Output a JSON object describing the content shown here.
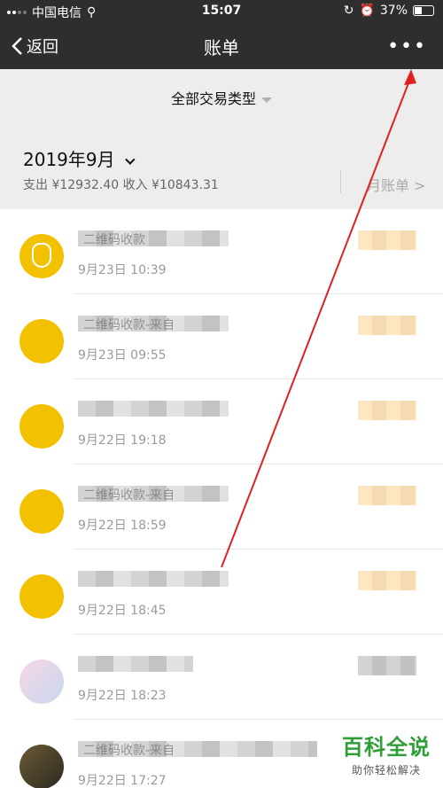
{
  "status_bar": {
    "carrier": "中国电信",
    "time": "15:07",
    "battery": "37%"
  },
  "nav": {
    "back_label": "返回",
    "title": "账单",
    "more_label": "•••"
  },
  "filter": {
    "label": "全部交易类型"
  },
  "month": {
    "title": "2019年9月",
    "summary": "支出 ¥12932.40 收入 ¥10843.31",
    "bill_link": "月账单 >"
  },
  "transactions": [
    {
      "title": "二维码收款",
      "time": "9月23日 10:39",
      "avatar": "coin-bag"
    },
    {
      "title": "二维码收款-来自",
      "time": "9月23日 09:55",
      "avatar": "yellow"
    },
    {
      "title": "",
      "time": "9月22日 19:18",
      "avatar": "yellow"
    },
    {
      "title": "二维码收款-来自",
      "time": "9月22日 18:59",
      "avatar": "yellow"
    },
    {
      "title": "",
      "time": "9月22日 18:45",
      "avatar": "yellow"
    },
    {
      "title": "",
      "time": "9月22日 18:23",
      "avatar": "faded"
    },
    {
      "title": "二维码收款-来自",
      "time": "9月22日 17:27",
      "avatar": "dark"
    }
  ],
  "watermark": {
    "main": "百科全说",
    "sub": "助你轻松解决"
  },
  "colors": {
    "nav_bg": "#2e2e2e",
    "accent_yellow": "#f2c200",
    "annotation_red": "#e02020",
    "watermark_green": "#2f9e37"
  }
}
